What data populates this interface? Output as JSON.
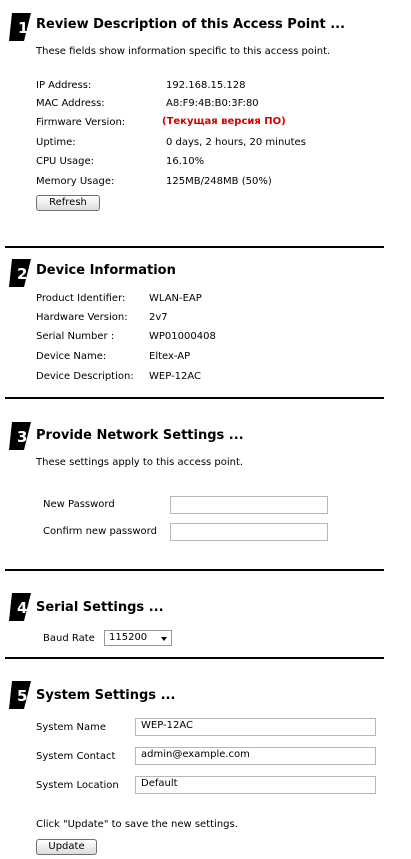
{
  "sections": [
    {
      "number": "1",
      "title": "Review Description of this Access Point ...",
      "description": "These fields show information specific to this access point.",
      "rows": [
        {
          "label": "IP Address:",
          "value": "192.168.15.128"
        },
        {
          "label": "MAC Address:",
          "value": "A8:F9:4B:B0:3F:80"
        },
        {
          "label": "Firmware Version:",
          "value": "(Текущая версия ПО)"
        },
        {
          "label": "Uptime:",
          "value": "0 days, 2 hours, 20 minutes"
        },
        {
          "label": "CPU Usage:",
          "value": "16.10%"
        },
        {
          "label": "Memory Usage:",
          "value": "125MB/248MB (50%)"
        }
      ],
      "refresh_label": "Refresh"
    },
    {
      "number": "2",
      "title": "Device Information",
      "rows": [
        {
          "label": "Product Identifier:",
          "value": "WLAN-EAP"
        },
        {
          "label": "Hardware Version:",
          "value": "2v7"
        },
        {
          "label": "Serial Number :",
          "value": "WP01000408"
        },
        {
          "label": "Device Name:",
          "value": "Eltex-AP"
        },
        {
          "label": "Device Description:",
          "value": "WEP-12AC"
        }
      ]
    },
    {
      "number": "3",
      "title": "Provide Network Settings ...",
      "description": "These settings apply to this access point.",
      "new_password_label": "New Password",
      "confirm_password_label": "Confirm new password",
      "new_password_value": "",
      "confirm_password_value": ""
    },
    {
      "number": "4",
      "title": "Serial Settings ...",
      "baud_rate_label": "Baud Rate",
      "baud_rate_value": "115200"
    },
    {
      "number": "5",
      "title": "System Settings ...",
      "system_name_label": "System Name",
      "system_name_value": "WEP-12AC",
      "system_contact_label": "System Contact",
      "system_contact_value": "admin@example.com",
      "system_location_label": "System Location",
      "system_location_value": "Default",
      "hint": "Click \"Update\" to save the new settings.",
      "update_label": "Update"
    }
  ],
  "colors": {
    "firmware_text": "#d40000",
    "divider": "#000000"
  }
}
